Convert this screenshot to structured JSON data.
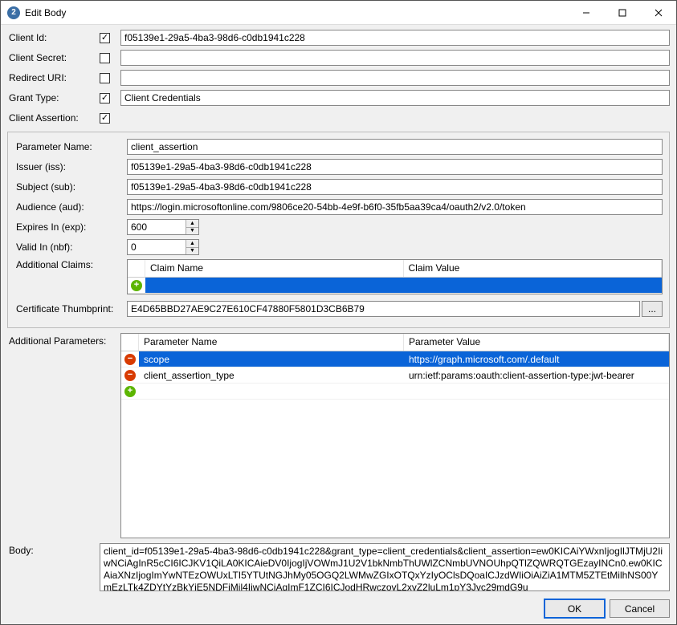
{
  "window": {
    "title": "Edit Body"
  },
  "labels": {
    "client_id": "Client Id:",
    "client_secret": "Client Secret:",
    "redirect_uri": "Redirect URI:",
    "grant_type": "Grant Type:",
    "client_assertion": "Client Assertion:",
    "parameter_name": "Parameter Name:",
    "issuer": "Issuer (iss):",
    "subject": "Subject (sub):",
    "audience": "Audience (aud):",
    "expires_in": "Expires In (exp):",
    "valid_in": "Valid In (nbf):",
    "additional_claims": "Additional Claims:",
    "certificate_thumbprint": "Certificate Thumbprint:",
    "additional_parameters": "Additional Parameters:",
    "body": "Body:"
  },
  "values": {
    "client_id": "f05139e1-29a5-4ba3-98d6-c0db1941c228",
    "client_secret": "",
    "redirect_uri": "",
    "grant_type": "Client Credentials",
    "parameter_name": "client_assertion",
    "issuer": "f05139e1-29a5-4ba3-98d6-c0db1941c228",
    "subject": "f05139e1-29a5-4ba3-98d6-c0db1941c228",
    "audience": "https://login.microsoftonline.com/9806ce20-54bb-4e9f-b6f0-35fb5aa39ca4/oauth2/v2.0/token",
    "expires_in": "600",
    "valid_in": "0",
    "certificate_thumbprint": "E4D65BBD27AE9C27E610CF47880F5801D3CB6B79",
    "body": "client_id=f05139e1-29a5-4ba3-98d6-c0db1941c228&grant_type=client_credentials&client_assertion=ew0KICAiYWxnIjogIlJTMjU2IiwNCiAgInR5cCI6ICJKV1QiLA0KICAieDV0IjogIjVOWmJ1U2V1bkNmbThUWlZCNmbUVNOUhpQTlZQWRQTGEzayINCn0.ew0KICAiaXNzIjogImYwNTEzOWUxLTI5YTUtNGJhMy05OGQ2LWMwZGIxOTQxYzIyOClsDQoaICJzdWIiOiAiZiA1MTM5ZTEtMilhNS00YmEzLTk4ZDYtYzBkYjE5NDFiMil4IiwNCiAgImF1ZCI6ICJodHRwczovL2xvZ2luLm1pY3Jvc29mdG9u"
  },
  "claims_grid": {
    "headers": {
      "name": "Claim Name",
      "value": "Claim Value"
    }
  },
  "params_grid": {
    "headers": {
      "name": "Parameter Name",
      "value": "Parameter Value"
    },
    "rows": [
      {
        "name": "scope",
        "value": "https://graph.microsoft.com/.default",
        "selected": true
      },
      {
        "name": "client_assertion_type",
        "value": "urn:ietf:params:oauth:client-assertion-type:jwt-bearer",
        "selected": false
      }
    ]
  },
  "buttons": {
    "ok": "OK",
    "cancel": "Cancel",
    "browse": "..."
  }
}
